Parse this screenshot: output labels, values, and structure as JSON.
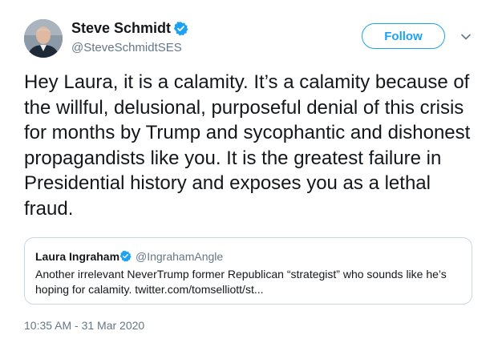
{
  "author": {
    "name": "Steve Schmidt",
    "handle": "@SteveSchmidtSES",
    "avatar_icon": "profile-photo-icon",
    "verified_icon": "verified-badge-icon"
  },
  "follow_label": "Follow",
  "menu_icon": "chevron-down-icon",
  "tweet_text": "Hey Laura, it is a calamity. It’s a calamity because of the willful, delusional, purposeful denial of this crisis for months by Trump and sycophantic and dishonest propagandists like you. It is the greatest failure in Presidential history and exposes you as a lethal fraud.",
  "quoted": {
    "name": "Laura Ingraham",
    "handle": "@IngrahamAngle",
    "text": "Another irrelevant NeverTrump former Republican “strategist” who sounds like he’s hoping for calamity. twitter.com/tomselliott/st...",
    "verified_icon": "verified-badge-icon"
  },
  "timestamp": "10:35 AM - 31 Mar 2020",
  "colors": {
    "accent": "#1da1f2",
    "text": "#14171a",
    "secondary": "#657786",
    "border": "#ccd6dd"
  }
}
